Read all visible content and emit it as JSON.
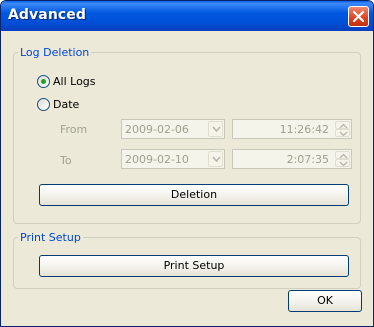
{
  "window": {
    "title": "Advanced"
  },
  "log_deletion": {
    "group_title": "Log Deletion",
    "all_logs_label": "All Logs",
    "date_label": "Date",
    "from_label": "From",
    "to_label": "To",
    "from_date": "2009-02-06",
    "from_time": "11:26:42",
    "to_date": "2009-02-10",
    "to_time": "2:07:35",
    "deletion_button": "Deletion",
    "selected": "All Logs"
  },
  "print_setup": {
    "group_title": "Print Setup",
    "button": "Print Setup"
  },
  "ok_button": "OK",
  "colors": {
    "title_bar": "#0058e0",
    "accent": "#0046d5",
    "selected_radio": "#21a121"
  }
}
